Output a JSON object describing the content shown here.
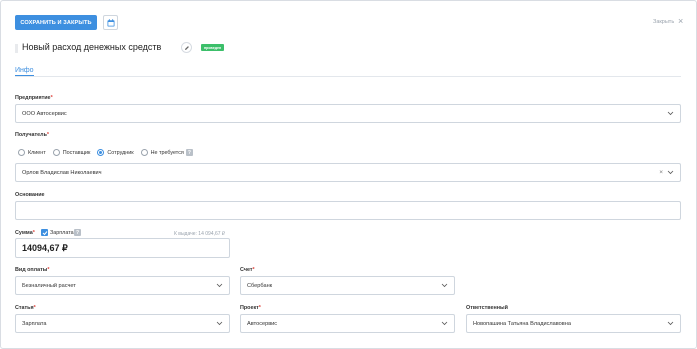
{
  "toolbar": {
    "save_label": "СОХРАНИТЬ И ЗАКРЫТЬ",
    "close_label": "Закрыть",
    "close_icon": "close-x"
  },
  "document": {
    "title": "Новый расход денежных средств",
    "status": "проведен",
    "status_color": "#3cbf6a"
  },
  "tabs": [
    {
      "label": "Инфо",
      "active": true
    }
  ],
  "form": {
    "enterprise": {
      "label": "Предприятие",
      "required": "*",
      "value": "ООО Автосервис"
    },
    "recipient": {
      "label": "Получатель",
      "required": "*",
      "options": [
        {
          "label": "Клиент",
          "checked": false
        },
        {
          "label": "Поставщик",
          "checked": false
        },
        {
          "label": "Сотрудник",
          "checked": true
        },
        {
          "label": "Не требуется",
          "checked": false
        }
      ],
      "help": "?",
      "value": "Орлов Владислав Николаевич"
    },
    "basis": {
      "label": "Основание",
      "value": ""
    },
    "amount": {
      "label": "Сумма",
      "required": "*",
      "salary_checkbox_label": "Зарплата",
      "salary_checked": true,
      "help": "?",
      "to_issue": "К выдаче: 14 094,67 ₽",
      "value": "14094,67 ₽"
    },
    "payment_type": {
      "label": "Вид оплаты",
      "required": "*",
      "value": "Безналичный расчет"
    },
    "account": {
      "label": "Счет",
      "required": "*",
      "value": "Сбербанк"
    },
    "article": {
      "label": "Статья",
      "required": "*",
      "value": "Зарплата"
    },
    "project": {
      "label": "Проект",
      "required": "*",
      "value": "Автосервис"
    },
    "responsible": {
      "label": "Ответственный",
      "value": "Новопашина Татьяна Владиславовна"
    }
  },
  "colors": {
    "accent": "#3d8fe0",
    "required": "#e0413a",
    "border": "#cfd6de"
  }
}
